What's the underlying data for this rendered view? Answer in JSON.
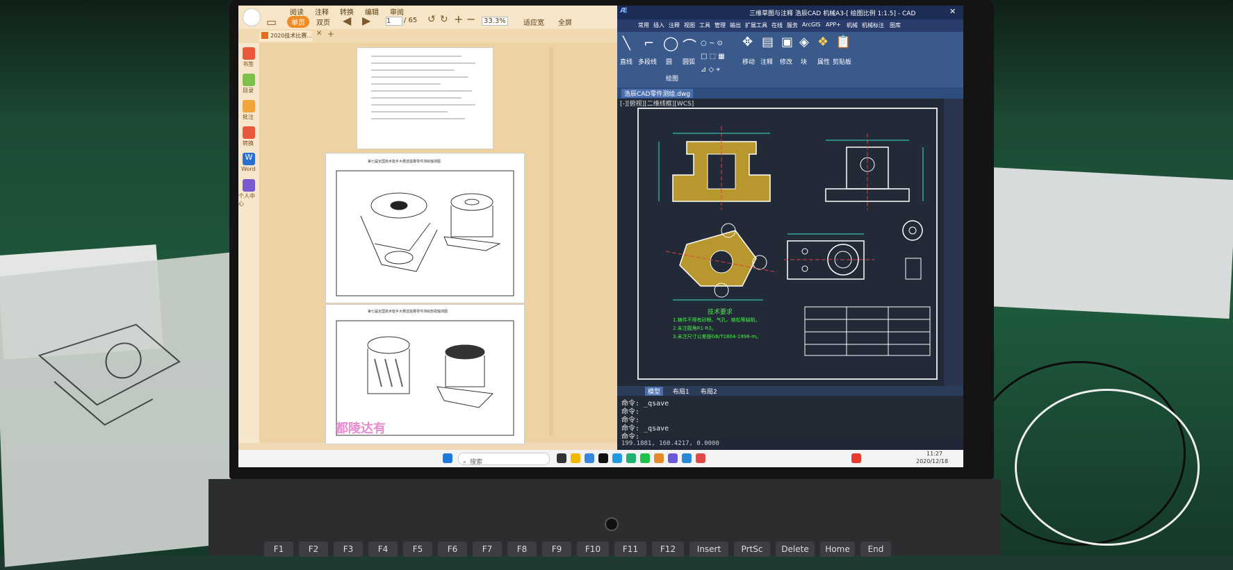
{
  "pdf_reader": {
    "toolbar": {
      "menu_1": "阅读",
      "menu_2": "注释",
      "menu_3": "转换",
      "menu_4": "编辑",
      "menu_5": "审阅",
      "single_page": "单页",
      "double_page": "双页",
      "page_current": "1",
      "page_total": "/ 65",
      "zoom": "33.3%",
      "fit_width": "适应宽",
      "fullscreen": "全屏"
    },
    "tab_title": "2020技术比赛...",
    "sidebar": [
      "书签",
      "目录",
      "批注",
      "转换",
      "Word",
      "个人中心"
    ],
    "page_2_caption": "第七届全国技术能手大赛选拔赛零件测绘轴测图",
    "page_3_caption": "第七届全国技术能手大赛选拔赛零件测绘剖视轴测图"
  },
  "cad": {
    "title": "三维草图与注释  浩辰CAD 机械A3-[ 绘图比例 1:1.5]  -  CAD",
    "ribbon_tabs": [
      "常用",
      "插入",
      "注释",
      "视图",
      "工具",
      "管理",
      "输出",
      "扩展工具",
      "在线",
      "服务",
      "ArcGIS",
      "APP+",
      "机械",
      "机械标注",
      "图库"
    ],
    "ribbon_buttons": [
      "直线",
      "多段线",
      "圆",
      "圆弧",
      "移动",
      "注释",
      "修改",
      "块",
      "属性",
      "剪贴板"
    ],
    "panel_label": "绘图",
    "doc_tab": "浩辰CAD零件测绘.dwg",
    "viewport_label": "[-][俯视][二维线框][WCS]",
    "layout_tabs": [
      "模型",
      "布局1",
      "布局2"
    ],
    "command_history": [
      "命令: _qsave",
      "命令:",
      "命令:",
      "命令: _qsave"
    ],
    "command_prompt": "命令:",
    "status_coords": "199.1881, 160.4217, 0.0000",
    "tech_req_title": "技术要求",
    "tech_req_lines": [
      "1.铸件不得有砂眼、气孔、缩松等缺陷。",
      "2.未注圆角R1-R3。",
      "3.未注尺寸公差按GB/T1804-1996-m。"
    ]
  },
  "taskbar": {
    "search_placeholder": "搜索",
    "time": "11:27",
    "date": "2020/12/18"
  },
  "watermark": "都陵达有",
  "keyboard_keys": [
    "F1",
    "F2",
    "F3",
    "F4",
    "F5",
    "F6",
    "F7",
    "F8",
    "F9",
    "F10",
    "F11",
    "F12",
    "Insert",
    "PrtSc",
    "Delete",
    "Home",
    "End"
  ]
}
